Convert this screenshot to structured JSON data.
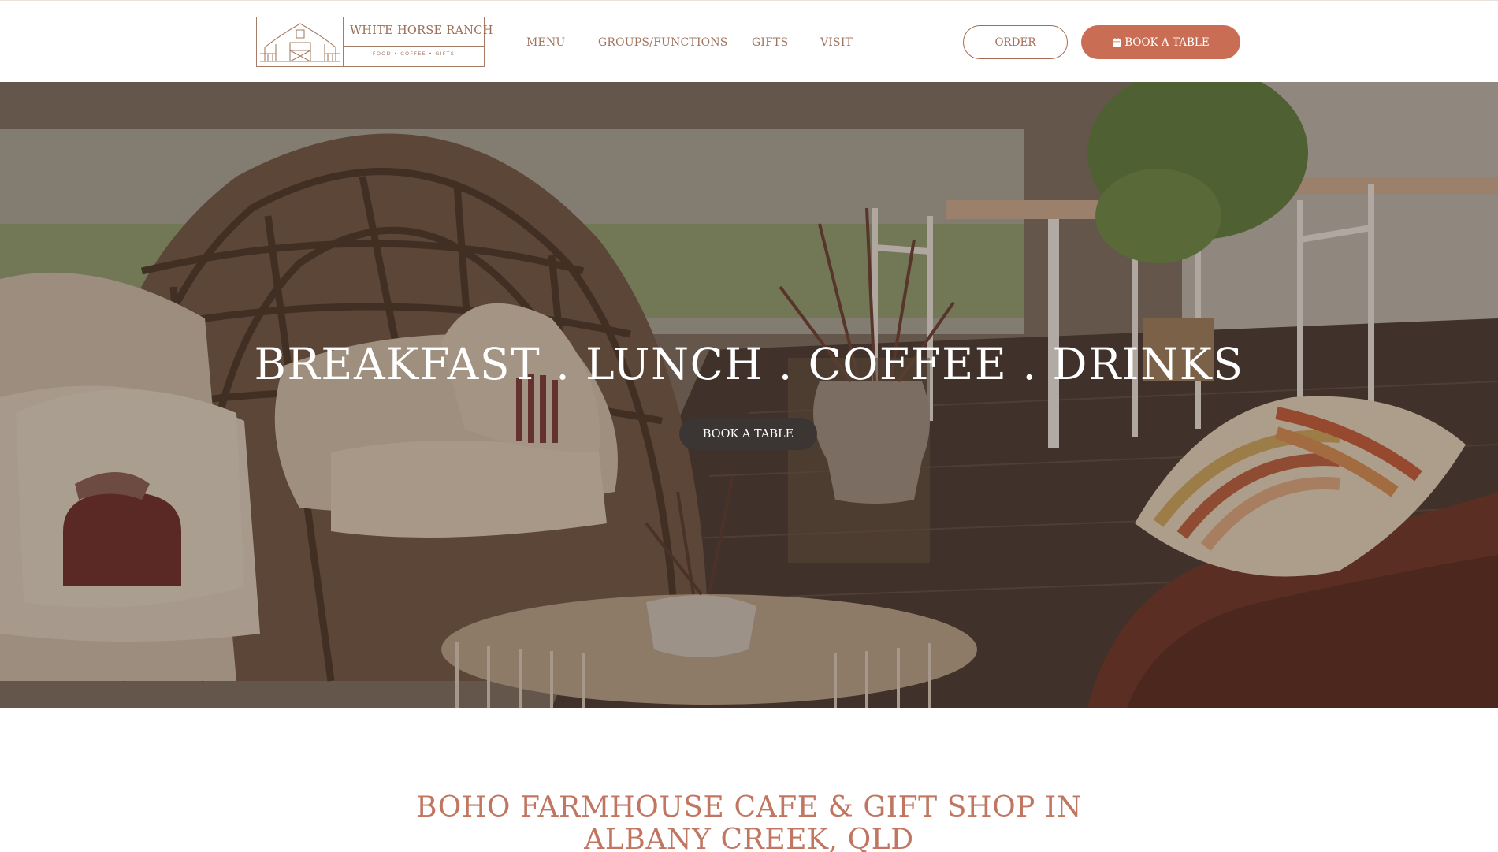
{
  "header": {
    "logo": {
      "brand": "WHITE HORSE RANCH",
      "tagline": "FOOD • COFFEE • GIFTS",
      "icon": "barn-icon"
    },
    "nav": [
      {
        "label": "MENU"
      },
      {
        "label": "GROUPS/FUNCTIONS"
      },
      {
        "label": "GIFTS"
      },
      {
        "label": "VISIT"
      }
    ],
    "order_label": "ORDER",
    "book_label": "BOOK A TABLE",
    "book_icon": "calendar-icon"
  },
  "hero": {
    "title": "BREAKFAST . LUNCH . COFFEE . DRINKS",
    "button_label": "BOOK A TABLE"
  },
  "intro": {
    "heading_line1": "BOHO FARMHOUSE CAFE & GIFT SHOP IN",
    "heading_line2": "ALBANY CREEK, QLD"
  },
  "colors": {
    "accent": "#c96e55",
    "heading": "#c07660",
    "nav_text": "#a07560",
    "dark_button": "#3b3633"
  }
}
